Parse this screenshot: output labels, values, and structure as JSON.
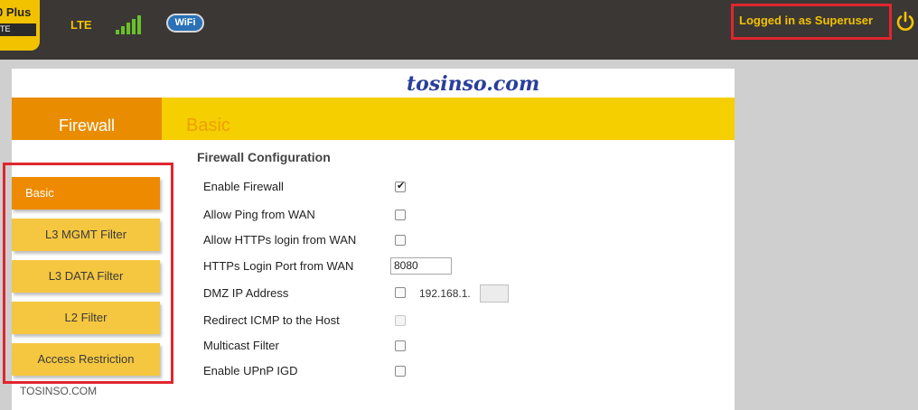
{
  "header": {
    "logo_text": "0 Plus",
    "logo_sub": "TE",
    "network_type": "LTE",
    "wifi_label": "WiFi",
    "login_status": "Logged in as Superuser",
    "icons": {
      "signal": "signal-bars-icon",
      "wifi": "wifi-badge-icon",
      "power": "power-icon"
    },
    "colors": {
      "accent": "#f2c200",
      "header_bg": "#3b3735",
      "highlight": "#e0262e"
    }
  },
  "watermark": "tosinso.com",
  "page": {
    "tab_label": "Firewall",
    "section_title": "Basic",
    "config_title": "Firewall Configuration"
  },
  "sidebar": {
    "items": [
      {
        "label": "Basic",
        "active": true
      },
      {
        "label": "L3 MGMT Filter",
        "active": false
      },
      {
        "label": "L3 DATA Filter",
        "active": false
      },
      {
        "label": "L2 Filter",
        "active": false
      },
      {
        "label": "Access Restriction",
        "active": false
      }
    ]
  },
  "footer_watermark": "TOSINSO.COM",
  "config": {
    "enable_firewall": {
      "label": "Enable Firewall",
      "checked": true
    },
    "allow_ping_wan": {
      "label": "Allow Ping from WAN",
      "checked": false
    },
    "allow_https_wan": {
      "label": "Allow HTTPs login from WAN",
      "checked": false
    },
    "https_port": {
      "label": "HTTPs Login Port from WAN",
      "value": "8080"
    },
    "dmz_ip": {
      "label": "DMZ IP Address",
      "checked": false,
      "prefix": "192.168.1.",
      "value": ""
    },
    "redirect_icmp": {
      "label": "Redirect ICMP to the Host",
      "checked": false,
      "disabled": true
    },
    "multicast_filter": {
      "label": "Multicast Filter",
      "checked": false
    },
    "enable_upnp": {
      "label": "Enable UPnP IGD",
      "checked": false
    }
  }
}
